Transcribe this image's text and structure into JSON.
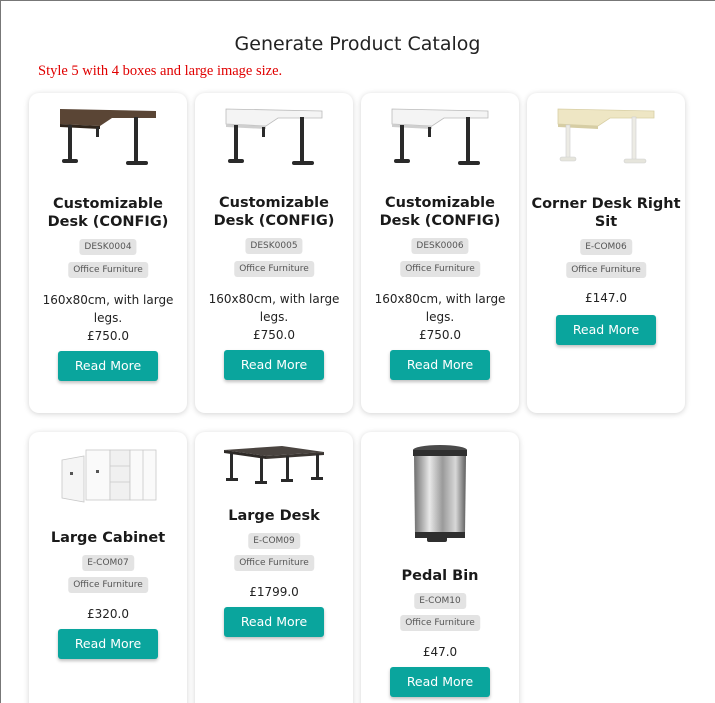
{
  "page": {
    "title": "Generate Product Catalog",
    "style_note": "Style 5 with 4 boxes and large image size."
  },
  "colors": {
    "accent": "#0aa59d",
    "note": "#e00000",
    "badge_bg": "#e3e3e3"
  },
  "products": [
    {
      "name": "Customizable Desk (CONFIG)",
      "sku": "DESK0004",
      "category": "Office Furniture",
      "description": "160x80cm, with large legs.",
      "price": "£750.0",
      "button": "Read More",
      "image": "dark-top-corner-desk-image"
    },
    {
      "name": "Customizable Desk (CONFIG)",
      "sku": "DESK0005",
      "category": "Office Furniture",
      "description": "160x80cm, with large legs.",
      "price": "£750.0",
      "button": "Read More",
      "image": "white-top-corner-desk-image"
    },
    {
      "name": "Customizable Desk (CONFIG)",
      "sku": "DESK0006",
      "category": "Office Furniture",
      "description": "160x80cm, with large legs.",
      "price": "£750.0",
      "button": "Read More",
      "image": "white-top-corner-desk-image"
    },
    {
      "name": "Corner Desk Right Sit",
      "sku": "E-COM06",
      "category": "Office Furniture",
      "description": "",
      "price": "£147.0",
      "button": "Read More",
      "image": "beige-corner-desk-image"
    },
    {
      "name": "Large Cabinet",
      "sku": "E-COM07",
      "category": "Office Furniture",
      "description": "",
      "price": "£320.0",
      "button": "Read More",
      "image": "white-cabinet-image"
    },
    {
      "name": "Large Desk",
      "sku": "E-COM09",
      "category": "Office Furniture",
      "description": "",
      "price": "£1799.0",
      "button": "Read More",
      "image": "dark-large-desk-image"
    },
    {
      "name": "Pedal Bin",
      "sku": "E-COM10",
      "category": "Office Furniture",
      "description": "",
      "price": "£47.0",
      "button": "Read More",
      "image": "pedal-bin-image"
    }
  ]
}
